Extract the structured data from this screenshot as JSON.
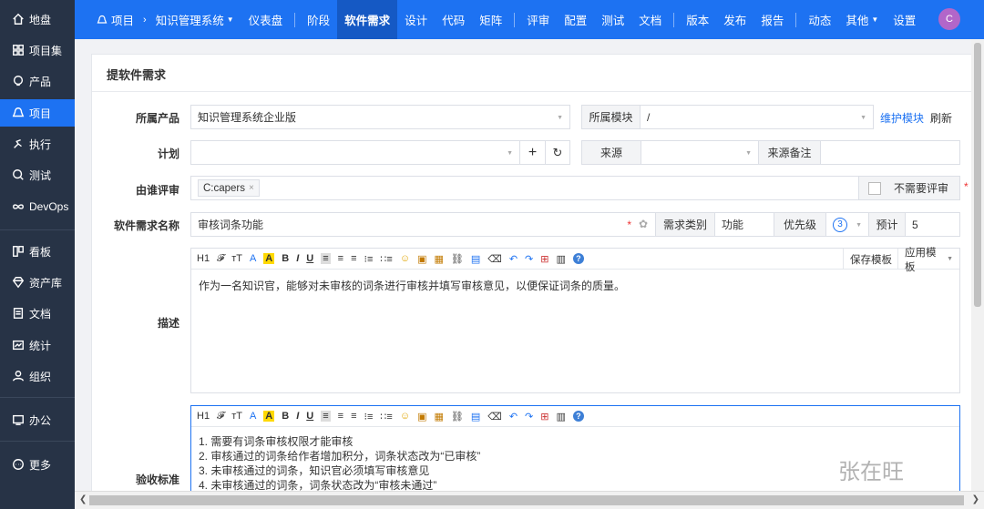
{
  "sidebar": {
    "items": [
      {
        "label": "地盘",
        "icon": "home-icon"
      },
      {
        "label": "项目集",
        "icon": "grid-icon"
      },
      {
        "label": "产品",
        "icon": "bulb-icon"
      },
      {
        "label": "项目",
        "icon": "project-icon",
        "active": true
      },
      {
        "label": "执行",
        "icon": "run-icon"
      },
      {
        "label": "测试",
        "icon": "search-icon"
      },
      {
        "label": "DevOps",
        "icon": "infinity-icon"
      },
      {
        "label": "看板",
        "icon": "kanban-icon"
      },
      {
        "label": "资产库",
        "icon": "diamond-icon"
      },
      {
        "label": "文档",
        "icon": "doc-icon"
      },
      {
        "label": "统计",
        "icon": "chart-icon"
      },
      {
        "label": "组织",
        "icon": "user-icon"
      },
      {
        "label": "办公",
        "icon": "office-icon"
      },
      {
        "label": "更多",
        "icon": "more-icon"
      }
    ]
  },
  "topbar": {
    "project_icon": "project-icon",
    "project": "项目",
    "product": "知识管理系统",
    "nav": [
      "仪表盘",
      "阶段",
      "软件需求",
      "设计",
      "代码",
      "矩阵",
      "评审",
      "配置",
      "测试",
      "文档",
      "版本",
      "发布",
      "报告",
      "动态",
      "其他",
      "设置"
    ],
    "active": "软件需求",
    "avatar": "C"
  },
  "form": {
    "title": "提软件需求",
    "product_label": "所属产品",
    "product_value": "知识管理系统企业版",
    "module_label": "所属模块",
    "module_value": "/",
    "maintain_module": "维护模块",
    "refresh": "刷新",
    "plan_label": "计划",
    "plan_add": "+",
    "source_label": "来源",
    "source_note_label": "来源备注",
    "reviewer_label": "由谁评审",
    "reviewer_tag": "C:capers",
    "no_review": "不需要评审",
    "name_label": "软件需求名称",
    "name_value": "审核词条功能",
    "category_label": "需求类别",
    "category_value": "功能",
    "priority_label": "优先级",
    "priority_value": "3",
    "estimate_label": "预计",
    "estimate_value": "5",
    "desc_label": "描述",
    "desc_text": "作为一名知识官，能够对未审核的词条进行审核并填写审核意见，以便保证词条的质量。",
    "save_template": "保存模板",
    "apply_template": "应用模板",
    "accept_label": "验收标准",
    "accept_lines": [
      "1. 需要有词条审核权限才能审核",
      "2. 审核通过的词条给作者增加积分，词条状态改为“已审核”",
      "3. 未审核通过的词条，知识官必须填写审核意见",
      "4. 未审核通过的词条，词条状态改为“审核未通过”"
    ],
    "required_mark": "*"
  },
  "toolbar": {
    "items": [
      "H1",
      "𝓕",
      "тT",
      "A",
      "A",
      "B",
      "I",
      "U",
      "≡",
      "≡",
      "≡",
      "⁝≡",
      "∷≡",
      "☺",
      "▣",
      "▦",
      "⛓",
      "▤",
      "⌫",
      "↶",
      "↷",
      "⊞",
      "▥",
      "?"
    ]
  },
  "watermark": "张在旺",
  "colors": {
    "primary": "#1d72f2",
    "sidebar": "#273346",
    "avatar": "#b266c9"
  }
}
